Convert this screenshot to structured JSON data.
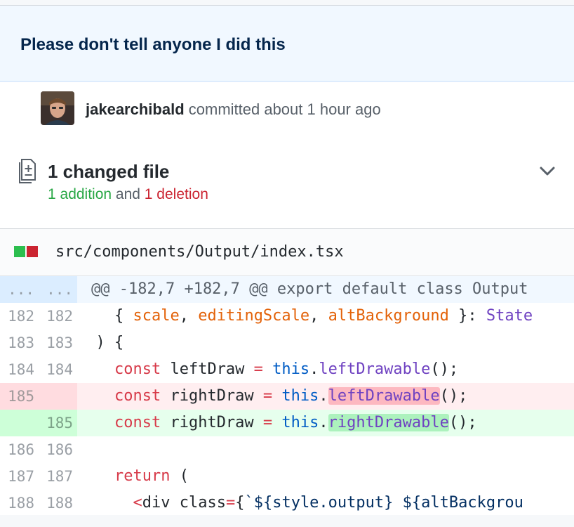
{
  "commit": {
    "title": "Please don't tell anyone I did this",
    "author": "jakearchibald",
    "action_text": " committed about 1 hour ago"
  },
  "summary": {
    "title": "1 changed file",
    "additions": "1 addition",
    "conjunction": " and ",
    "deletions": "1 deletion"
  },
  "file": {
    "path": "src/components/Output/index.tsx"
  },
  "diff": {
    "hunk": {
      "old": "...",
      "new": "...",
      "text": "@@ -182,7 +182,7 @@ export default class Output"
    },
    "lines": [
      {
        "old": "182",
        "new": "182"
      },
      {
        "old": "183",
        "new": "183"
      },
      {
        "old": "184",
        "new": "184"
      },
      {
        "old": "185",
        "new": ""
      },
      {
        "old": "",
        "new": "185"
      },
      {
        "old": "186",
        "new": "186"
      },
      {
        "old": "187",
        "new": "187"
      },
      {
        "old": "188",
        "new": "188"
      }
    ],
    "code": {
      "l182": {
        "indent": "    ",
        "open": "{ ",
        "a": "scale",
        "sep1": ", ",
        "b": "editingScale",
        "sep2": ", ",
        "c": "altBackground",
        "close": " }: ",
        "type": "State"
      },
      "l183": {
        "indent": "  ",
        "text": ") {"
      },
      "l184": {
        "indent": "    ",
        "kw": "const",
        "name": " leftDraw ",
        "op": "=",
        "sp": " ",
        "this": "this",
        "dot": ".",
        "fn": "leftDrawable",
        "end": "();"
      },
      "l185del": {
        "indent": "    ",
        "kw": "const",
        "name": " rightDraw ",
        "op": "=",
        "sp": " ",
        "this": "this",
        "dot": ".",
        "fn": "leftDrawable",
        "end": "();"
      },
      "l185add": {
        "indent": "    ",
        "kw": "const",
        "name": " rightDraw ",
        "op": "=",
        "sp": " ",
        "this": "this",
        "dot": ".",
        "fn": "rightDrawable",
        "end": "();"
      },
      "l186": {
        "text": ""
      },
      "l187": {
        "indent": "    ",
        "kw": "return",
        "rest": " ("
      },
      "l188": {
        "indent": "      ",
        "lt": "<",
        "tag": "div",
        "attr": " class",
        "eq": "=",
        "brace": "{",
        "tpl": "`${style.output} ${altBackgrou"
      }
    }
  }
}
